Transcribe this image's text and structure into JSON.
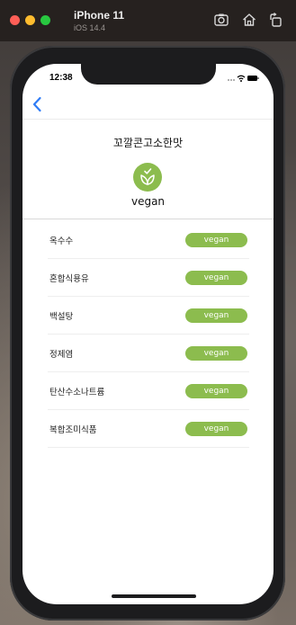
{
  "simulator": {
    "device_name": "iPhone 11",
    "os_version": "iOS 14.4"
  },
  "status_bar": {
    "time": "12:38"
  },
  "product": {
    "title": "꼬깔콘고소한맛",
    "diet_label": "vegan",
    "accent_color": "#8cbc4e"
  },
  "ingredients": [
    {
      "name": "옥수수",
      "tag": "vegan"
    },
    {
      "name": "혼합식용유",
      "tag": "vegan"
    },
    {
      "name": "백설탕",
      "tag": "vegan"
    },
    {
      "name": "정제염",
      "tag": "vegan"
    },
    {
      "name": "탄산수소나트륨",
      "tag": "vegan"
    },
    {
      "name": "복합조미식품",
      "tag": "vegan"
    }
  ]
}
